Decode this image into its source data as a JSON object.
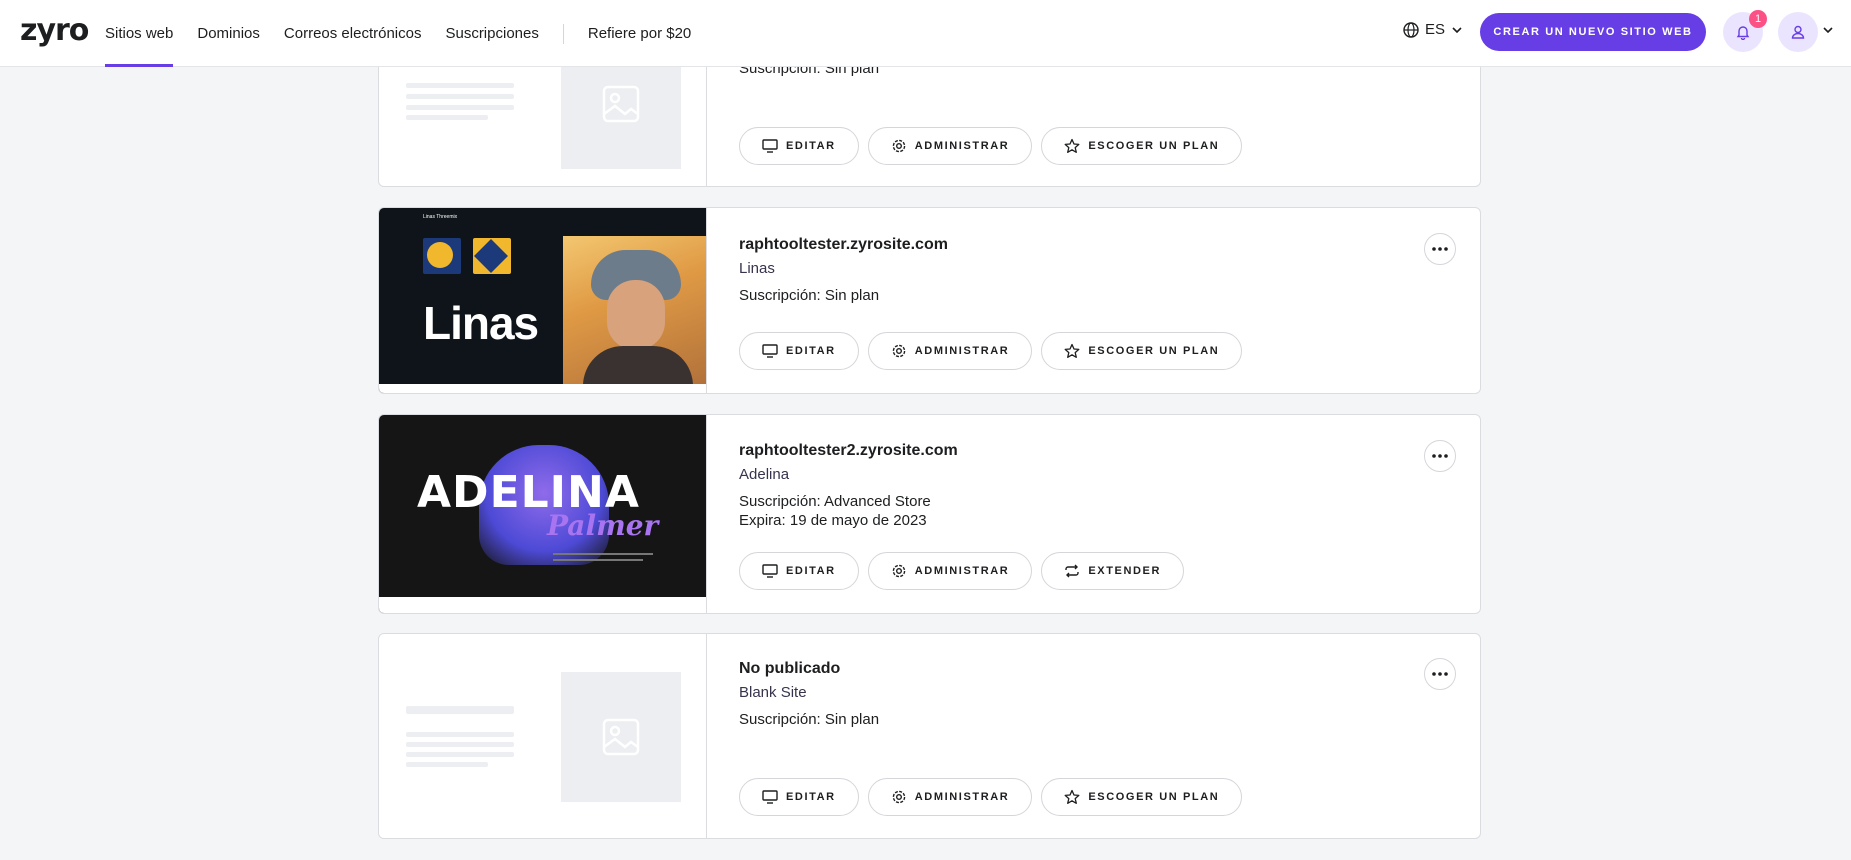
{
  "header": {
    "logo": "zyro",
    "nav": [
      {
        "label": "Sitios web",
        "active": true
      },
      {
        "label": "Dominios",
        "active": false
      },
      {
        "label": "Correos electrónicos",
        "active": false
      },
      {
        "label": "Suscripciones",
        "active": false
      }
    ],
    "refer_label": "Refiere por $20",
    "lang": "ES",
    "create_button": "CREAR UN NUEVO SITIO WEB",
    "notification_count": "1"
  },
  "buttons": {
    "edit": "EDITAR",
    "manage": "ADMINISTRAR",
    "choose_plan": "ESCOGER UN PLAN",
    "extend": "EXTENDER"
  },
  "sites": [
    {
      "name": "",
      "template": "",
      "subscription": "Suscripción: Sin plan",
      "expires": "",
      "third_button": "ESCOGER UN PLAN"
    },
    {
      "name": "raphtooltester.zyrosite.com",
      "template": "Linas",
      "subscription": "Suscripción: Sin plan",
      "expires": "",
      "third_button": "ESCOGER UN PLAN",
      "thumb_text": "Linas"
    },
    {
      "name": "raphtooltester2.zyrosite.com",
      "template": "Adelina",
      "subscription": "Suscripción: Advanced Store",
      "expires": "Expira: 19 de mayo de 2023",
      "third_button": "EXTENDER",
      "thumb_text": "ADELINA",
      "thumb_text2": "Palmer"
    },
    {
      "name": "No publicado",
      "template": "Blank Site",
      "subscription": "Suscripción: Sin plan",
      "expires": "",
      "third_button": "ESCOGER UN PLAN"
    }
  ],
  "colors": {
    "accent": "#673de6",
    "badge": "#fc5185",
    "background": "#f4f5f7"
  }
}
